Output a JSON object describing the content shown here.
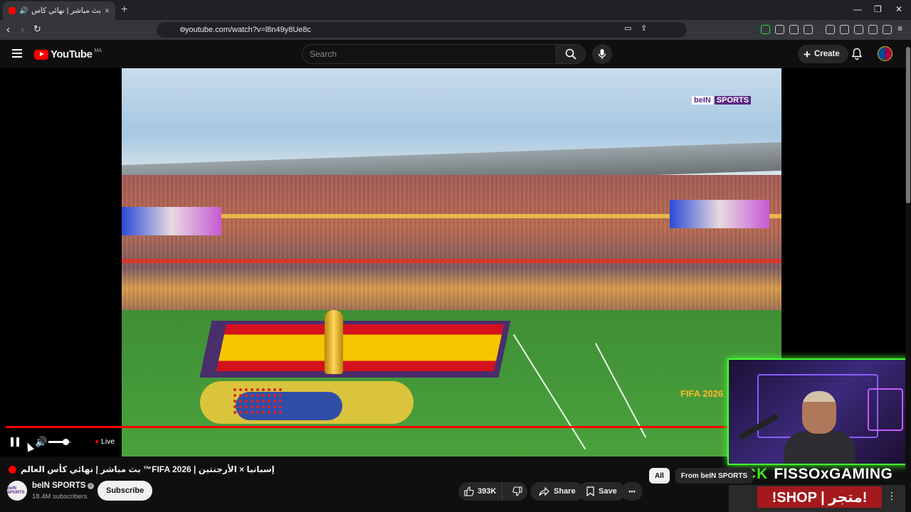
{
  "browser": {
    "tab_title": "بث مباشر | نهائي كأس العالم...",
    "tab_close": "×",
    "new_tab": "+",
    "url": "youtube.com/watch?v=l8n49y8Ue8c",
    "window_controls": [
      "—",
      "❐",
      "✕"
    ],
    "icons": [
      "back-icon",
      "forward-icon",
      "reload-icon",
      "bookmark-icon",
      "site-info-icon",
      "cast-icon",
      "share-icon",
      "brave-shield-icon",
      "brave-rewards-icon"
    ]
  },
  "youtube": {
    "logo_text": "YouTube",
    "country_code": "MA",
    "search_placeholder": "Search",
    "create_label": "Create"
  },
  "player": {
    "live_label": "Live",
    "channel_bug": {
      "left": "beIN",
      "right": "SPORTS"
    },
    "watermark": "FIFA 2026",
    "volume_fraction": 0.75
  },
  "overlay": {
    "kick_label": "KICK",
    "streamer": "FISSOxGAMING",
    "shop": "!SHOP | متجر!"
  },
  "video": {
    "title": "إسبانيا × الأرجنتين | FIFA 2026™ بث مباشر | نهائي كأس العالم",
    "channel": "beIN SPORTS",
    "channel_avatar_text": "beIN SPORTS",
    "subscribers": "18.4M subscribers",
    "subscribe_label": "Subscribe",
    "likes": "393K",
    "share_label": "Share",
    "save_label": "Save",
    "more_label": "•••"
  },
  "chips": [
    "All",
    "From beIN SPORTS"
  ],
  "colors": {
    "accent": "#ff0000",
    "kick_green": "#3cf01c",
    "shop_red": "#a3191c",
    "bein_purple": "#5b2a86"
  }
}
